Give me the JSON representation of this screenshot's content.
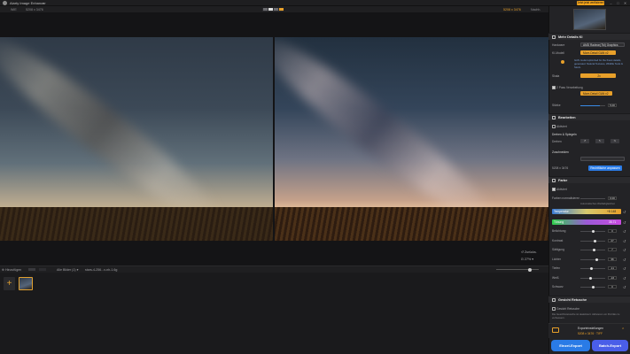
{
  "window": {
    "title": "Aiarty Image Enhancer",
    "caret": "v",
    "upgrade_label": "Jetzt jetzt verifizieren",
    "min": "–",
    "max": "□",
    "close": "✕"
  },
  "imagebar": {
    "left_label": "WIE",
    "left_size": "5208 x 3476",
    "right_size": "5208 x 3476",
    "right_label": "Nachh."
  },
  "canvas": {
    "reset_label": "Zurücks.",
    "zoom_label": "27%"
  },
  "filmbar": {
    "add_label": "Hinzufügen",
    "sort_label": "Alle Bilder (1) ▾",
    "file_label": "stars-4-256...x-nh-1.6g"
  },
  "panel": {
    "model_section": {
      "title": "Mehr Details KI",
      "rows": [
        {
          "label": "Hardware",
          "value": "AMD Radeon(TM) Graphics"
        },
        {
          "label": "KI-Modell",
          "value": "More-Detail GAN v2"
        },
        {
          "label": "Skala",
          "value": "2x"
        }
      ],
      "note": "GAN model optimized for the finest details, generated. Natural Textures, Wildlife Texts & Stock.",
      "checkbox_label": "2 Pass Verarbeitung",
      "checkbox_value": "More-Detail GAN v2",
      "strength_label": "Stärke",
      "strength_value": "5.00",
      "strength_pct": 0.8
    },
    "edit_section": {
      "title": "Bearbeiten",
      "enabled_label": "Aktiviert",
      "rotate_label": "Drehen & Spiegeln",
      "rotate_sub": "Drehen",
      "seg": [
        "↺",
        "↻",
        "⇋"
      ],
      "crop_label": "Zuschneiden",
      "crop_dims": "5208 x 3476",
      "crop_btn": "Rechtfläche anpassen"
    },
    "color_section": {
      "title": "Farbe",
      "enabled_label": "Aktiviert",
      "auto_label": "Farben normalisieren",
      "auto_value": "0.00",
      "hint": "Automatisches Weißabgleichen",
      "temperature_label": "Temperatur",
      "temperature_value": "+8 148",
      "tint_label": "Tönung",
      "tint_value": "35.71",
      "sliders": [
        {
          "label": "Belichtung",
          "value": "0",
          "pct": 0.5
        },
        {
          "label": "Kontrast",
          "value": "27",
          "pct": 0.6
        },
        {
          "label": "Sättigung",
          "value": "7",
          "pct": 0.55
        },
        {
          "label": "Lichter",
          "value": "36",
          "pct": 0.65
        },
        {
          "label": "Tiefen",
          "value": "-11",
          "pct": 0.45
        },
        {
          "label": "Weiß",
          "value": "-16",
          "pct": 0.42
        },
        {
          "label": "Schwarz",
          "value": "0",
          "pct": 0.5
        }
      ]
    },
    "face_section": {
      "title": "Gesicht Retusche",
      "enabled_label": "Gesicht Retusche",
      "hint": "Die Gesichtsretusche ist deaktiviert. Aktivieren um Porträts zu verbessern."
    },
    "export": {
      "settings_label": "Exporteinstellungen",
      "settings_value": "5208 x 3476 · TIFF",
      "single_label": "Einzel-Export",
      "batch_label": "Batch-Export"
    }
  }
}
